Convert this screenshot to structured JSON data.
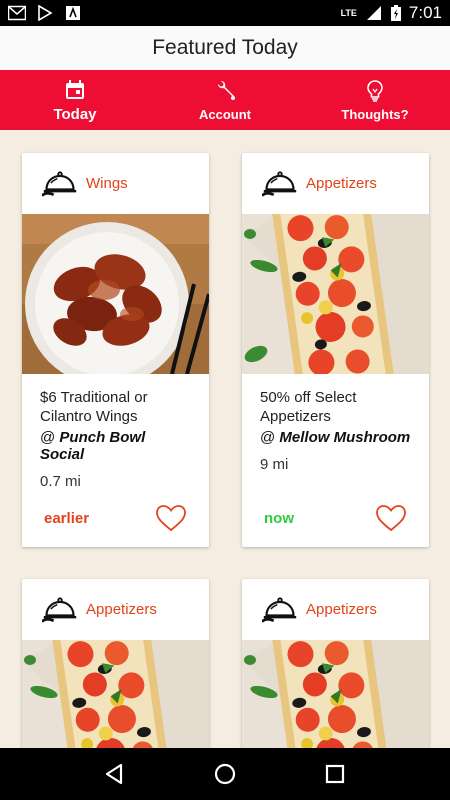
{
  "status_bar": {
    "time": "7:01",
    "network": "LTE",
    "icons": [
      "gmail-icon",
      "play-store-icon",
      "news-icon",
      "signal-icon",
      "battery-icon"
    ]
  },
  "app_bar": {
    "title": "Featured Today"
  },
  "tabs": [
    {
      "label": "Today",
      "icon": "calendar-icon",
      "active": true
    },
    {
      "label": "Account",
      "icon": "wrench-icon",
      "active": false
    },
    {
      "label": "Thoughts?",
      "icon": "lightbulb-icon",
      "active": false
    }
  ],
  "cards": [
    {
      "category": "Wings",
      "title": "$6 Traditional or Cilantro Wings",
      "venue_prefix": "@",
      "venue": "Punch Bowl Social",
      "distance": "0.7 mi",
      "when": "earlier",
      "when_color": "#e2431a",
      "image": "chicken-wings-photo"
    },
    {
      "category": "Appetizers",
      "title": "50% off Select Appetizers",
      "venue_prefix": "@",
      "venue": "Mellow Mushroom",
      "distance": "9 mi",
      "when": "now",
      "when_color": "#2ecc40",
      "image": "tomato-tart-photo"
    },
    {
      "category": "Appetizers",
      "image": "tomato-tart-photo"
    },
    {
      "category": "Appetizers",
      "image": "tomato-tart-photo"
    }
  ],
  "colors": {
    "accent": "#ef0e33",
    "category": "#e2431a",
    "background": "#f5ede1"
  }
}
